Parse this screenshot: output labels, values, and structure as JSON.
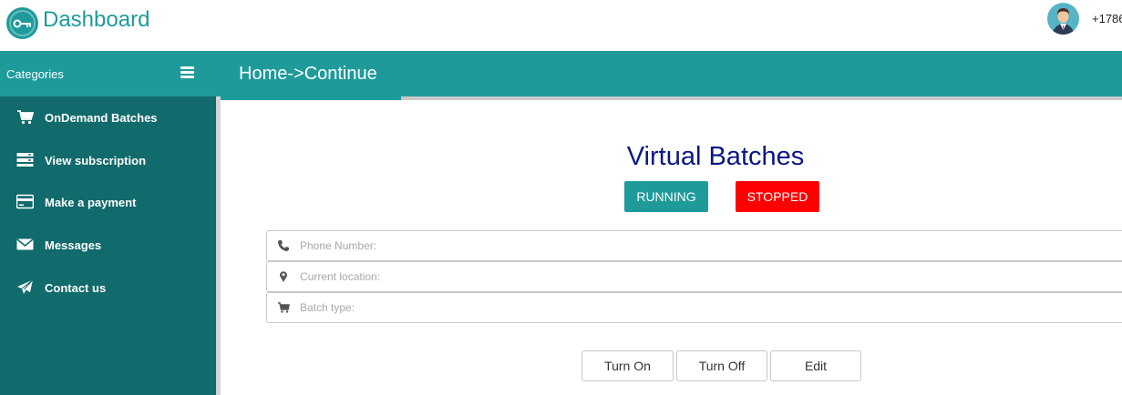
{
  "header": {
    "app_title": "Dashboard",
    "phone": "+1786",
    "logo_icon": "key-icon",
    "avatar_icon": "user-avatar-icon"
  },
  "sidebar": {
    "heading": "Categories",
    "toggle_icon": "hamburger-icon",
    "items": [
      {
        "label": "OnDemand Batches",
        "icon": "cart-icon"
      },
      {
        "label": "View subscription",
        "icon": "server-icon"
      },
      {
        "label": "Make a payment",
        "icon": "credit-card-icon"
      },
      {
        "label": "Messages",
        "icon": "envelope-icon"
      },
      {
        "label": "Contact us",
        "icon": "paper-plane-icon"
      }
    ]
  },
  "content": {
    "breadcrumb": "Home->Continue",
    "progress_percent": 20,
    "title": "Virtual Batches",
    "status_buttons": {
      "running": "RUNNING",
      "stopped": "STOPPED"
    },
    "fields": [
      {
        "placeholder": "Phone Number:",
        "value": "",
        "icon": "phone-icon"
      },
      {
        "placeholder": "Current location:",
        "value": "",
        "icon": "map-marker-icon"
      },
      {
        "placeholder": "Batch type:",
        "value": "",
        "icon": "cart-icon"
      }
    ],
    "actions": {
      "turn_on": "Turn On",
      "turn_off": "Turn Off",
      "edit": "Edit"
    }
  },
  "colors": {
    "accent": "#1e9a9b",
    "sidebar_bg": "#116a6b",
    "title": "#0a1786",
    "stopped": "#ff0000"
  }
}
